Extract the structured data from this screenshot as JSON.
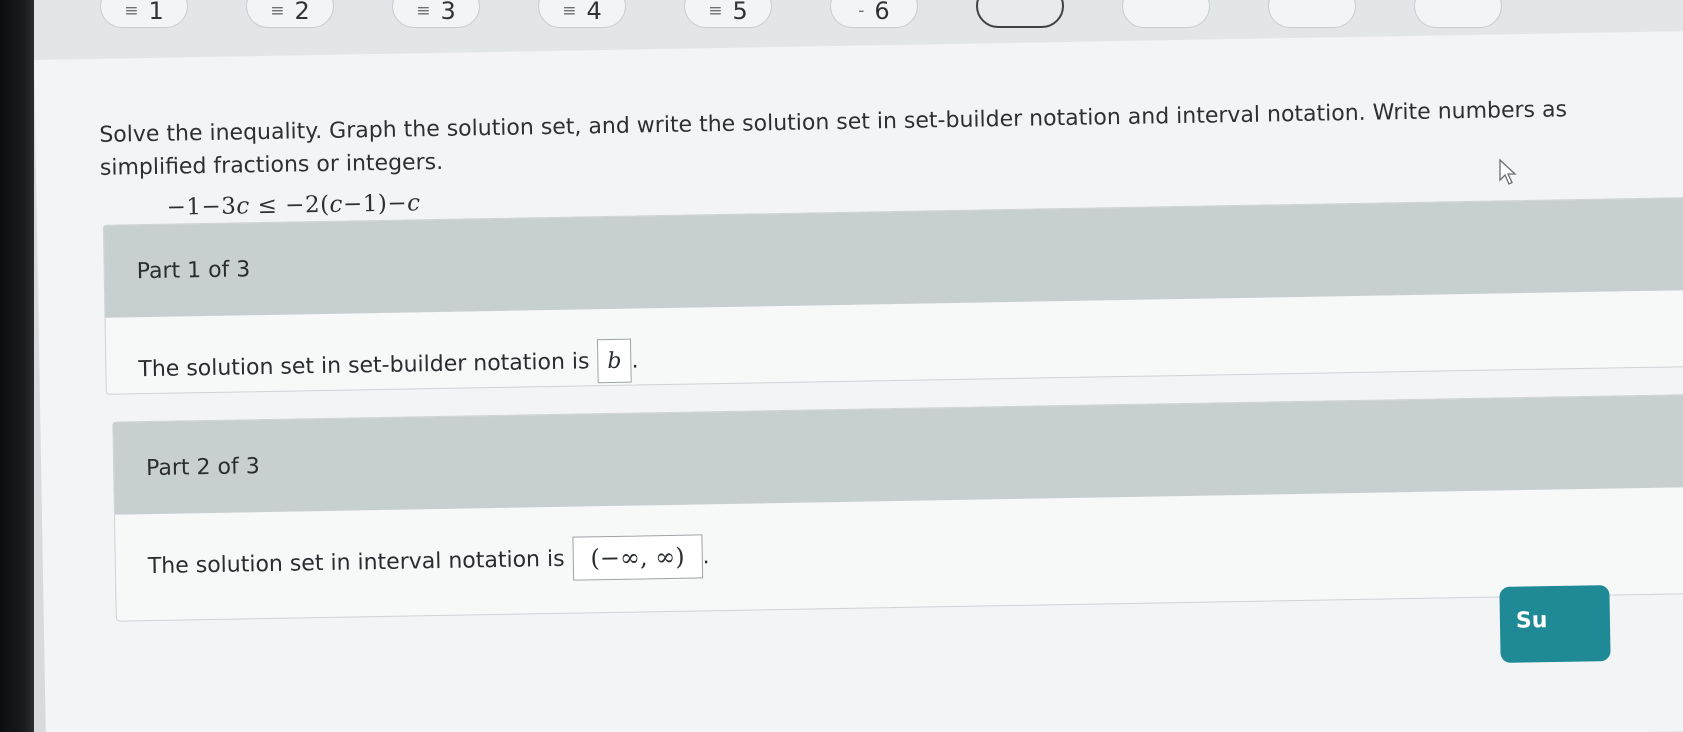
{
  "question_nav": [
    {
      "label": "1"
    },
    {
      "label": "2"
    },
    {
      "label": "3"
    },
    {
      "label": "4"
    },
    {
      "label": "5"
    },
    {
      "label": "6"
    },
    {
      "label": ""
    },
    {
      "label": ""
    },
    {
      "label": ""
    },
    {
      "label": ""
    }
  ],
  "problem": {
    "instructions": "Solve the inequality. Graph the solution set, and write the solution set in set-builder notation and interval notation. Write numbers as simplified fractions or integers.",
    "inequality": {
      "lhs_a": "−1−3",
      "var1": "c",
      "op": " ≤ −2(",
      "var2": "c",
      "mid": "−1)−",
      "var3": "c"
    }
  },
  "parts": [
    {
      "header": "Part 1 of 3",
      "prompt": "The solution set in set-builder notation is",
      "answer": "b",
      "suffix": "."
    },
    {
      "header": "Part 2 of 3",
      "prompt": "The solution set in interval notation is",
      "answer": "(−∞, ∞)",
      "suffix": "."
    }
  ],
  "submit_label": "Su",
  "colors": {
    "submit": "#1f8a95",
    "part_header": "#c8cfd1",
    "card": "#f3f4f5"
  }
}
